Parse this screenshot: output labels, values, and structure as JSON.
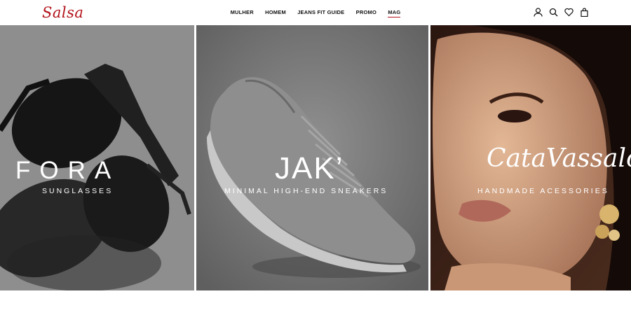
{
  "brand": {
    "logo_text": "Salsa",
    "accent_color": "#b3121b"
  },
  "nav": {
    "items": [
      {
        "label": "MULHER"
      },
      {
        "label": "HOMEM"
      },
      {
        "label": "JEANS FIT GUIDE"
      },
      {
        "label": "PROMO"
      },
      {
        "label": "MAG",
        "active": true
      }
    ]
  },
  "header_icons": [
    "user-icon",
    "search-icon",
    "heart-icon",
    "bag-icon"
  ],
  "panels": [
    {
      "title": "FORA",
      "subtitle": "SUNGLASSES"
    },
    {
      "title": "JAK’",
      "subtitle": "MINIMAL HIGH-END SNEAKERS"
    },
    {
      "title": "CataVassalo",
      "subtitle": "HANDMADE ACESSORIES"
    }
  ]
}
